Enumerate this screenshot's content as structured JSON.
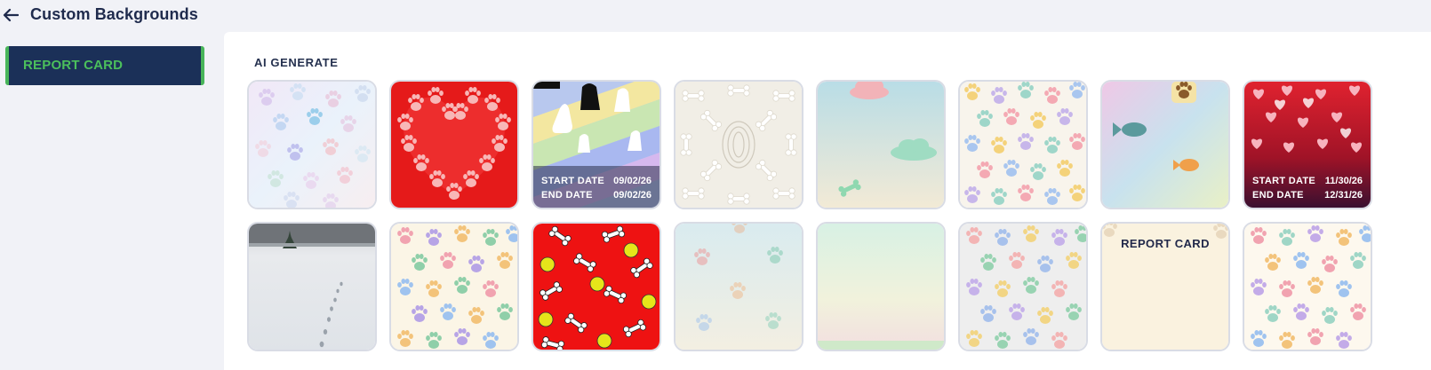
{
  "header": {
    "title": "Custom Backgrounds",
    "back_icon": "arrow-left-icon"
  },
  "sidebar": {
    "items": [
      {
        "label": "REPORT CARD",
        "active": true
      }
    ]
  },
  "main": {
    "section_label": "AI GENERATE",
    "tiles": [
      {
        "name": "pastel-paws"
      },
      {
        "name": "red-paw-heart"
      },
      {
        "name": "pet-silhouettes",
        "start_label": "START DATE",
        "start_date": "09/02/26",
        "end_label": "END DATE",
        "end_date": "09/02/26"
      },
      {
        "name": "bones-pattern"
      },
      {
        "name": "sky-clouds"
      },
      {
        "name": "rainbow-paws"
      },
      {
        "name": "fish-pastel"
      },
      {
        "name": "hearts-valentine",
        "start_label": "START DATE",
        "start_date": "11/30/26",
        "end_label": "END DATE",
        "end_date": "12/31/26"
      },
      {
        "name": "snow-tracks"
      },
      {
        "name": "cream-paws"
      },
      {
        "name": "red-bones-balls"
      },
      {
        "name": "faded-paws"
      },
      {
        "name": "mint-gradient"
      },
      {
        "name": "grey-paws"
      },
      {
        "name": "report-card-cream",
        "title": "REPORT CARD"
      },
      {
        "name": "cats-paws"
      }
    ]
  },
  "colors": {
    "sidebar_active_bg": "#1b3058",
    "sidebar_active_accent": "#48b55a",
    "page_bg": "#f1f2f7"
  }
}
